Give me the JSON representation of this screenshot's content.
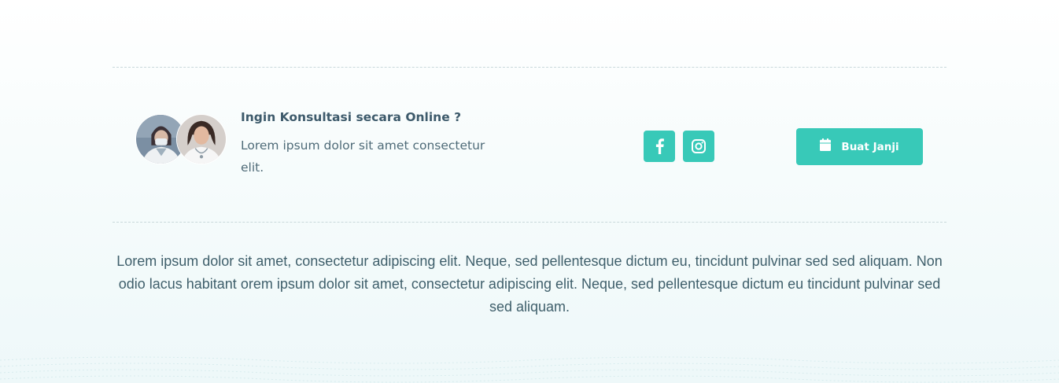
{
  "cta": {
    "title": "Ingin Konsultasi secara Online ?",
    "description": "Lorem ipsum dolor sit amet consectetur elit."
  },
  "social": {
    "facebook_icon": "facebook-icon",
    "instagram_icon": "instagram-icon"
  },
  "appointment_button": {
    "icon": "calendar-icon",
    "label": "Buat Janji"
  },
  "footer": {
    "text": "Lorem ipsum dolor sit amet, consectetur adipiscing elit. Neque, sed pellentesque dictum eu, tincidunt pulvinar sed sed aliquam. Non odio lacus habitant orem ipsum dolor sit amet, consectetur adipiscing elit. Neque, sed pellentesque dictum eu tincidunt pulvinar sed sed aliquam."
  },
  "colors": {
    "accent": "#38c9b8",
    "heading": "#3d5a6b",
    "text": "#4f6b78"
  }
}
